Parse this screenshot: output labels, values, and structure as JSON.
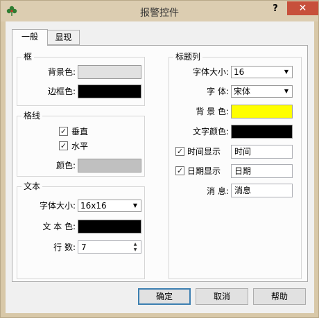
{
  "window": {
    "title": "报警控件",
    "help_label": "?",
    "close_label": "✕"
  },
  "tabs": [
    {
      "label": "一般"
    },
    {
      "label": "显现"
    }
  ],
  "frame_group": {
    "title": "框",
    "background_label": "背景色:",
    "border_label": "边框色:",
    "background_color": "#e1e1e1",
    "border_color": "#000000"
  },
  "grid_group": {
    "title": "格线",
    "vertical_label": "垂直",
    "vertical_checked": true,
    "horizontal_label": "水平",
    "horizontal_checked": true,
    "color_label": "颜色:",
    "color": "#c0c0c0"
  },
  "text_group": {
    "title": "文本",
    "font_size_label": "字体大小:",
    "font_size_value": "16x16",
    "text_color_label": "文 本 色:",
    "text_color": "#000000",
    "rows_label": "行    数:",
    "rows_value": "7"
  },
  "title_group": {
    "title": "标题列",
    "font_size_label": "字体大小:",
    "font_size_value": "16",
    "font_label": "字    体:",
    "font_value": "宋体",
    "background_label": "背 景 色:",
    "background_color": "#ffff00",
    "text_color_label": "文字颜色:",
    "text_color": "#000000",
    "show_time_label": "时间显示",
    "show_time_checked": true,
    "time_value": "时间",
    "show_date_label": "日期显示",
    "show_date_checked": true,
    "date_value": "日期",
    "message_label": "消    息:",
    "message_value": "消息"
  },
  "buttons": {
    "ok": "确定",
    "cancel": "取消",
    "help": "帮助"
  },
  "icons": {
    "check": "✓",
    "dropdown": "▼",
    "spin_up": "▲",
    "spin_down": "▼"
  }
}
